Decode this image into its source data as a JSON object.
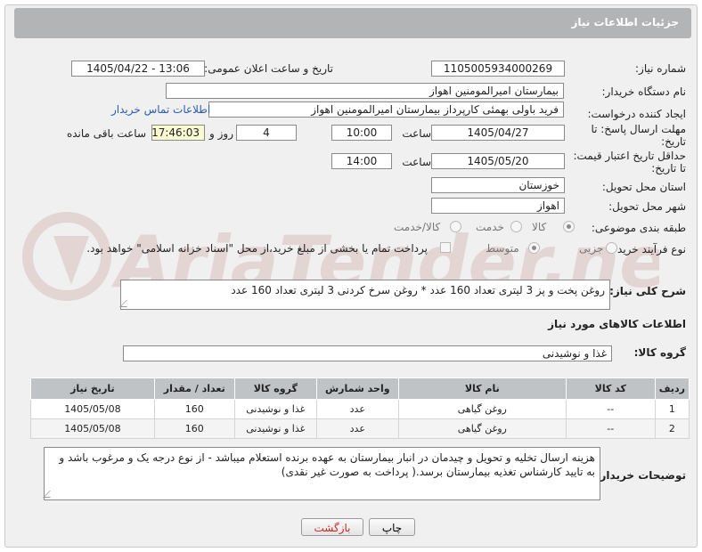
{
  "header": {
    "title": "جزئیات اطلاعات نیاز"
  },
  "fields": {
    "need_number_label": "شماره نیاز:",
    "need_number": "1105005934000269",
    "announce_label": "تاریخ و ساعت اعلان عمومی:",
    "announce_value": "1405/04/22 - 13:06",
    "buyer_org_label": "نام دستگاه خریدار:",
    "buyer_org": "بیمارستان امیرالمومنین اهواز",
    "requester_label": "ایجاد کننده درخواست:",
    "requester": "فرید باولی بهمئی کارپرداز بیمارستان امیرالمومنین اهواز",
    "contact_link": "اطلاعات تماس خریدار",
    "reply_deadline_label_1": "مهلت ارسال پاسخ: تا",
    "reply_deadline_label_2": "تاریخ:",
    "reply_date": "1405/04/27",
    "time_label": "ساعت",
    "reply_time": "10:00",
    "reply_days": "4",
    "days_label": "روز و",
    "reply_remaining": "17:46:03",
    "remaining_label": "ساعت باقی مانده",
    "price_validity_label_1": "حداقل تاریخ اعتبار قیمت:",
    "price_validity_label_2": "تا تاریخ:",
    "price_date": "1405/05/20",
    "price_time": "14:00",
    "province_label": "استان محل تحویل:",
    "province": "خوزستان",
    "city_label": "شهر محل تحویل:",
    "city": "اهواز",
    "category_label": "طبقه بندی موضوعی:",
    "category_options": [
      "کالا",
      "خدمت",
      "کالا/خدمت"
    ],
    "category_selected": "کالا",
    "process_label": "نوع فرآیند خرید :",
    "process_options": [
      "جزیی",
      "متوسط"
    ],
    "process_selected": "متوسط",
    "treasury_text": "پرداخت تمام یا بخشی از مبلغ خرید،از محل \"اسناد خزانه اسلامی\" خواهد بود."
  },
  "description": {
    "label": "شرح کلی نیاز:",
    "text": "روغن پخت و پز 3 لیتری تعداد 160 عدد * روغن سرخ کردنی 3 لیتری تعداد 160 عدد"
  },
  "goods": {
    "section_title": "اطلاعات کالاهای مورد نیاز",
    "group_label": "گروه کالا:",
    "group_value": "غذا و نوشیدنی",
    "columns": [
      "ردیف",
      "کد کالا",
      "نام کالا",
      "واحد شمارش",
      "گروه کالا",
      "تعداد / مقدار",
      "تاریخ نیاز"
    ],
    "rows": [
      [
        "1",
        "--",
        "روغن گیاهی",
        "عدد",
        "غذا و نوشیدنی",
        "160",
        "1405/05/08"
      ],
      [
        "2",
        "--",
        "روغن گیاهی",
        "عدد",
        "غذا و نوشیدنی",
        "160",
        "1405/05/08"
      ]
    ]
  },
  "buyer_notes": {
    "label": "توضیحات خریدار:",
    "text": "هزینه ارسال تخلیه و تحویل و چیدمان در انبار بیمارستان به عهده برنده استعلام میباشد - از نوع درجه یک  و مرغوب باشد و به تایید کارشناس تغذیه بیمارستان برسد.( پرداخت به صورت غیر نقدی)"
  },
  "buttons": {
    "print": "چاپ",
    "back": "بازگشت"
  },
  "colors": {
    "header": "#b2b4b6",
    "link": "#2a5db0",
    "back_button": "#c62828",
    "yellow_box": "#fafad2"
  },
  "watermark": {
    "brand": "AriaTender.net"
  }
}
